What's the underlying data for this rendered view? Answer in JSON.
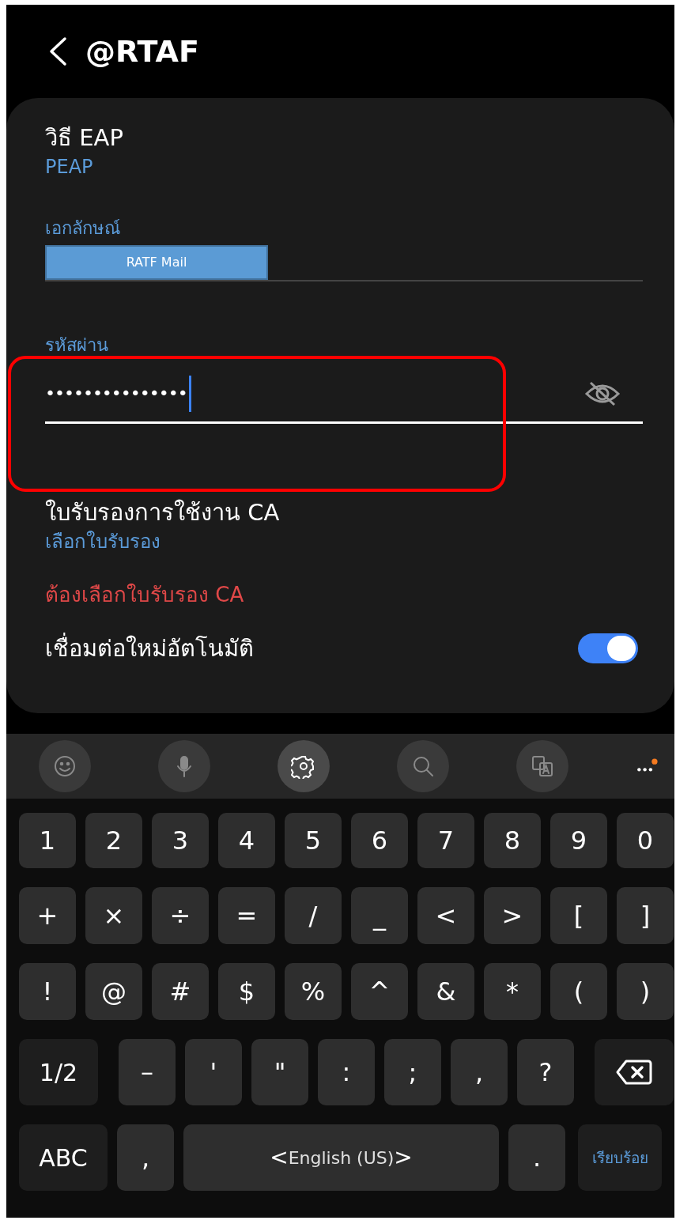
{
  "header": {
    "title": "@RTAF"
  },
  "eap_method": {
    "label": "วิธี EAP",
    "value": "PEAP"
  },
  "identity": {
    "label": "เอกลักษณ์",
    "overlay_label": "RATF Mail"
  },
  "password": {
    "label": "รหัสผ่าน",
    "value": "•••••••••••••••",
    "focused": true,
    "highlighted": true
  },
  "ca_certificate": {
    "label": "ใบรับรองการใช้งาน CA",
    "value": "เลือกใบรับรอง",
    "error": "ต้องเลือกใบรับรอง CA"
  },
  "auto_reconnect": {
    "label": "เชื่อมต่อใหม่อัตโนมัติ",
    "on": true
  },
  "keyboard": {
    "toolbar": [
      {
        "kind": "emoji",
        "enabled": false
      },
      {
        "kind": "mic",
        "enabled": false
      },
      {
        "kind": "settings",
        "enabled": true
      },
      {
        "kind": "search",
        "enabled": false
      },
      {
        "kind": "translate",
        "enabled": false
      },
      {
        "kind": "more",
        "enabled": true
      }
    ],
    "rows": [
      {
        "keys": [
          {
            "kind": "key",
            "label": "1"
          },
          {
            "kind": "key",
            "label": "2"
          },
          {
            "kind": "key",
            "label": "3"
          },
          {
            "kind": "key",
            "label": "4"
          },
          {
            "kind": "key",
            "label": "5"
          },
          {
            "kind": "key",
            "label": "6"
          },
          {
            "kind": "key",
            "label": "7"
          },
          {
            "kind": "key",
            "label": "8"
          },
          {
            "kind": "key",
            "label": "9"
          },
          {
            "kind": "key",
            "label": "0"
          }
        ]
      },
      {
        "keys": [
          {
            "kind": "key",
            "label": "+"
          },
          {
            "kind": "key",
            "label": "×"
          },
          {
            "kind": "key",
            "label": "÷"
          },
          {
            "kind": "key",
            "label": "="
          },
          {
            "kind": "key",
            "label": "/"
          },
          {
            "kind": "key",
            "label": "_"
          },
          {
            "kind": "key",
            "label": "<"
          },
          {
            "kind": "key",
            "label": ">"
          },
          {
            "kind": "key",
            "label": "["
          },
          {
            "kind": "key",
            "label": "]"
          }
        ]
      },
      {
        "keys": [
          {
            "kind": "key",
            "label": "!"
          },
          {
            "kind": "key",
            "label": "@"
          },
          {
            "kind": "key",
            "label": "#"
          },
          {
            "kind": "key",
            "label": "$"
          },
          {
            "kind": "key",
            "label": "%"
          },
          {
            "kind": "key",
            "label": "^"
          },
          {
            "kind": "key",
            "label": "&"
          },
          {
            "kind": "key",
            "label": "*"
          },
          {
            "kind": "key",
            "label": "("
          },
          {
            "kind": "key",
            "label": ")"
          }
        ]
      },
      {
        "keys": [
          {
            "kind": "mode",
            "label": "1/2"
          },
          {
            "kind": "key",
            "label": "–"
          },
          {
            "kind": "key",
            "label": "'"
          },
          {
            "kind": "key",
            "label": "\""
          },
          {
            "kind": "key",
            "label": ":"
          },
          {
            "kind": "key",
            "label": ";"
          },
          {
            "kind": "key",
            "label": ","
          },
          {
            "kind": "key",
            "label": "?"
          },
          {
            "kind": "backspace"
          }
        ]
      },
      {
        "keys": [
          {
            "kind": "mode",
            "label": "ABC"
          },
          {
            "kind": "key",
            "label": ","
          },
          {
            "kind": "space",
            "label": "English (US)",
            "prev": "<",
            "next": ">"
          },
          {
            "kind": "key",
            "label": "."
          },
          {
            "kind": "action",
            "label": "เรียบร้อย"
          }
        ]
      }
    ]
  }
}
